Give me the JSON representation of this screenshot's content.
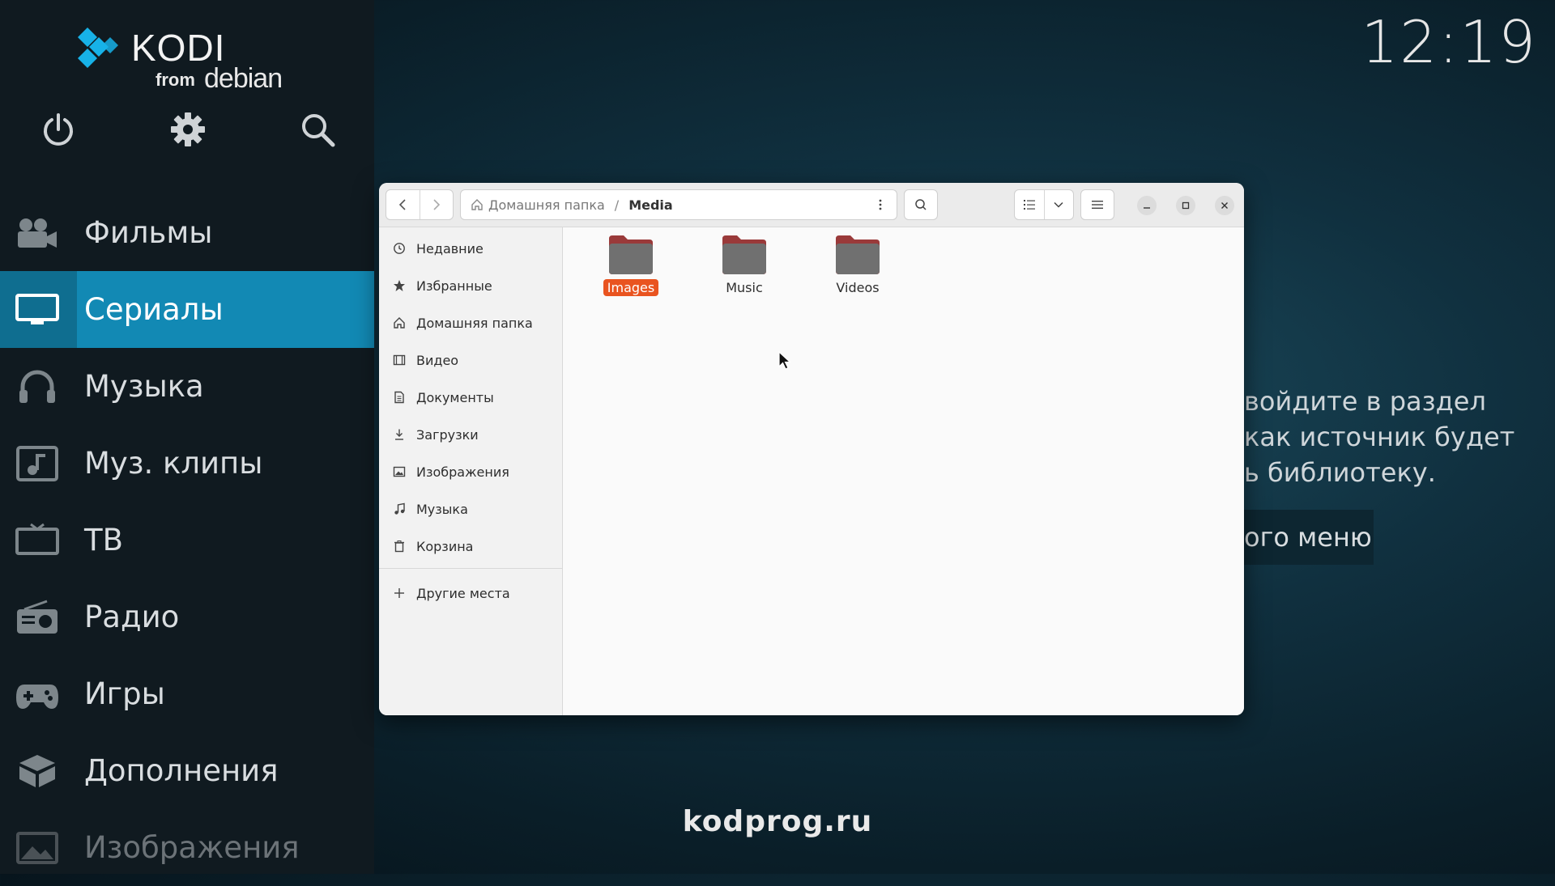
{
  "kodi": {
    "logo_word": "KODI",
    "logo_from": "from",
    "logo_distro": "debian",
    "top_icons": [
      "power-icon",
      "gear-icon",
      "search-icon"
    ],
    "menu": [
      {
        "label": "Фильмы",
        "icon": "movie-camera-icon",
        "state": "normal"
      },
      {
        "label": "Сериалы",
        "icon": "tv-monitor-icon",
        "state": "active"
      },
      {
        "label": "Музыка",
        "icon": "headphones-icon",
        "state": "normal"
      },
      {
        "label": "Муз. клипы",
        "icon": "music-video-icon",
        "state": "normal"
      },
      {
        "label": "ТВ",
        "icon": "tv-icon",
        "state": "normal"
      },
      {
        "label": "Радио",
        "icon": "radio-icon",
        "state": "normal"
      },
      {
        "label": "Игры",
        "icon": "gamepad-icon",
        "state": "normal"
      },
      {
        "label": "Дополнения",
        "icon": "addons-box-icon",
        "state": "normal"
      },
      {
        "label": "Изображения",
        "icon": "image-icon",
        "state": "dim"
      }
    ],
    "clock": "12:19",
    "hint_lines": [
      "войдите в раздел",
      "как источник будет",
      "ь библиотеку."
    ],
    "hint_button": "ого меню",
    "footer_site": "kodprog.ru",
    "accent": "#1289b4"
  },
  "file_manager": {
    "breadcrumb": {
      "home": "Домашняя папка",
      "current": "Media"
    },
    "sidebar": [
      {
        "label": "Недавние",
        "icon": "clock-icon"
      },
      {
        "label": "Избранные",
        "icon": "star-icon"
      },
      {
        "label": "Домашняя папка",
        "icon": "home-icon"
      },
      {
        "label": "Видео",
        "icon": "film-icon"
      },
      {
        "label": "Документы",
        "icon": "document-icon"
      },
      {
        "label": "Загрузки",
        "icon": "download-icon"
      },
      {
        "label": "Изображения",
        "icon": "picture-icon"
      },
      {
        "label": "Музыка",
        "icon": "music-note-icon"
      },
      {
        "label": "Корзина",
        "icon": "trash-icon"
      }
    ],
    "other_places": "Другие места",
    "folders": [
      {
        "label": "Images",
        "selected": true
      },
      {
        "label": "Music",
        "selected": false
      },
      {
        "label": "Videos",
        "selected": false
      }
    ],
    "selection_color": "#e95420",
    "folder_color": "#7a7a7a"
  }
}
